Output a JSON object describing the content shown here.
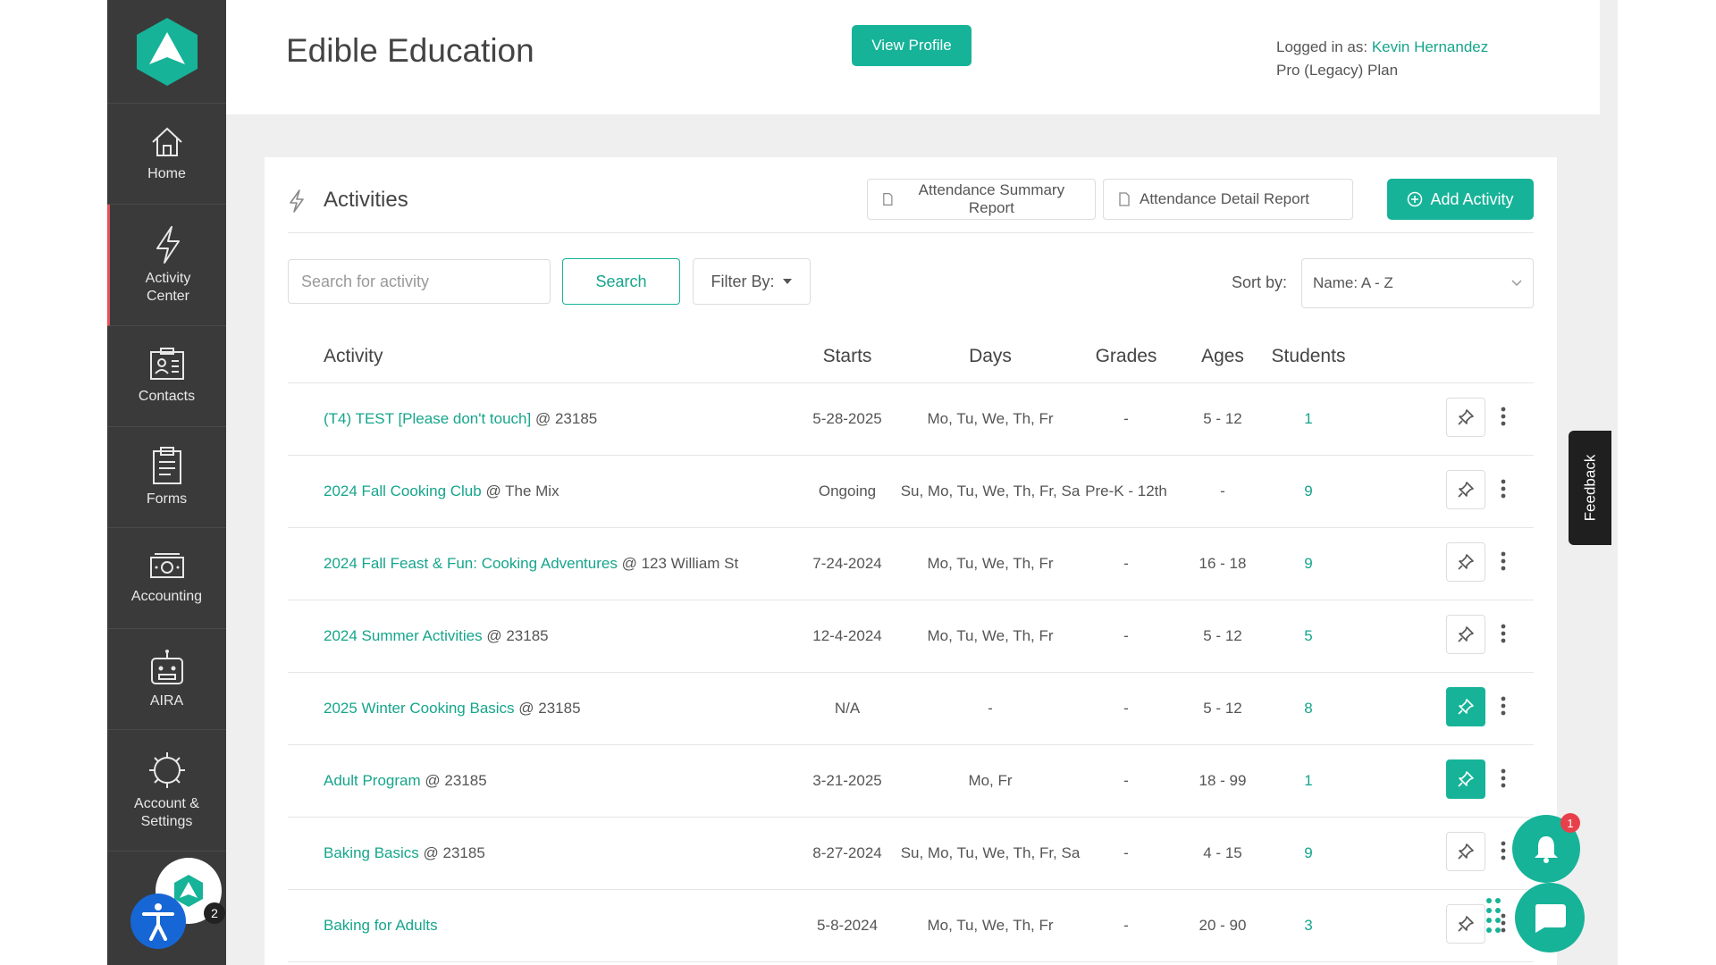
{
  "sidebar": {
    "items": [
      {
        "label": "Home",
        "icon": "home-icon"
      },
      {
        "label": "Activity Center",
        "icon": "bolt-icon"
      },
      {
        "label": "Contacts",
        "icon": "contacts-icon"
      },
      {
        "label": "Forms",
        "icon": "clipboard-icon"
      },
      {
        "label": "Accounting",
        "icon": "money-icon"
      },
      {
        "label": "AIRA",
        "icon": "robot-icon"
      },
      {
        "label": "Account & Settings",
        "icon": "gear-icon"
      }
    ],
    "active": "Activity Center",
    "active_color": "#e2525c"
  },
  "header": {
    "title": "Edible Education",
    "view_profile_label": "View Profile",
    "logged_in_prefix": "Logged in as:",
    "user_name": "Kevin Hernandez",
    "plan": "Pro (Legacy) Plan"
  },
  "activities": {
    "title": "Activities",
    "attendance_summary_label": "Attendance Summary Report",
    "attendance_detail_label": "Attendance Detail Report",
    "add_activity_label": "Add Activity",
    "search_placeholder": "Search for activity",
    "search_label": "Search",
    "filter_label": "Filter By:",
    "sort_label": "Sort by:",
    "sort_value": "Name: A - Z",
    "columns": [
      "Activity",
      "Starts",
      "Days",
      "Grades",
      "Ages",
      "Students"
    ],
    "rows": [
      {
        "name": "(T4) TEST [Please don't touch]",
        "location": "@ 23185",
        "starts": "5-28-2025",
        "days": "Mo, Tu, We, Th, Fr",
        "grades": "-",
        "ages": "5 - 12",
        "students": "1",
        "pinned": false
      },
      {
        "name": "2024 Fall Cooking Club",
        "location": "@ The Mix",
        "starts": "Ongoing",
        "days": "Su, Mo, Tu, We, Th, Fr, Sa",
        "grades": "Pre-K - 12th",
        "ages": "-",
        "students": "9",
        "pinned": false
      },
      {
        "name": "2024 Fall Feast & Fun: Cooking Adventures",
        "location": "@ 123 William St",
        "starts": "7-24-2024",
        "days": "Mo, Tu, We, Th, Fr",
        "grades": "-",
        "ages": "16 - 18",
        "students": "9",
        "pinned": false
      },
      {
        "name": "2024 Summer Activities",
        "location": "@ 23185",
        "starts": "12-4-2024",
        "days": "Mo, Tu, We, Th, Fr",
        "grades": "-",
        "ages": "5 - 12",
        "students": "5",
        "pinned": false
      },
      {
        "name": "2025 Winter Cooking Basics",
        "location": "@ 23185",
        "starts": "N/A",
        "days": "-",
        "grades": "-",
        "ages": "5 - 12",
        "students": "8",
        "pinned": true
      },
      {
        "name": "Adult Program",
        "location": "@ 23185",
        "starts": "3-21-2025",
        "days": "Mo, Fr",
        "grades": "-",
        "ages": "18 - 99",
        "students": "1",
        "pinned": true
      },
      {
        "name": "Baking Basics",
        "location": "@ 23185",
        "starts": "8-27-2024",
        "days": "Su, Mo, Tu, We, Th, Fr, Sa",
        "grades": "-",
        "ages": "4 - 15",
        "students": "9",
        "pinned": false
      },
      {
        "name": "Baking for Adults",
        "location": "",
        "starts": "5-8-2024",
        "days": "Mo, Tu, We, Th, Fr",
        "grades": "-",
        "ages": "20 - 90",
        "students": "3",
        "pinned": false
      }
    ]
  },
  "feedback_label": "Feedback",
  "notifications": {
    "count": "1"
  },
  "widget_badge": "2",
  "brand_color": "#16b398"
}
